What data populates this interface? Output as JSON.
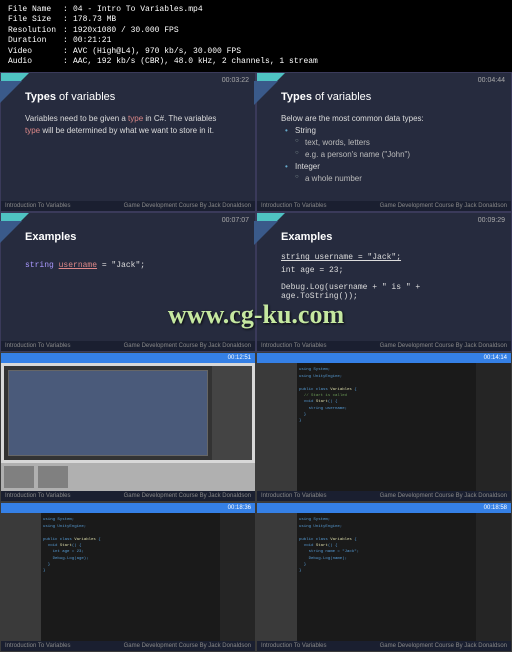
{
  "info": {
    "fileName": {
      "label": "File Name",
      "value": "04 - Intro To Variables.mp4"
    },
    "fileSize": {
      "label": "File Size",
      "value": "178.73 MB"
    },
    "resolution": {
      "label": "Resolution",
      "value": "1920x1080 / 30.000 FPS"
    },
    "duration": {
      "label": "Duration",
      "value": "00:21:21"
    },
    "video": {
      "label": "Video",
      "value": "AVC (High@L4), 970 kb/s, 30.000 FPS"
    },
    "audio": {
      "label": "Audio",
      "value": "AAC, 192 kb/s (CBR), 48.0 kHz, 2 channels, 1 stream"
    }
  },
  "slides": {
    "s1": {
      "ts": "00:03:22",
      "titleBold": "Types",
      "titleRest": " of variables",
      "line1a": "Variables need to be given a ",
      "line1hl": "type",
      "line1b": " in C#. The variables ",
      "line2a": "type",
      "line2b": " will be determined by what we want to store in it."
    },
    "s2": {
      "ts": "00:04:44",
      "titleBold": "Types",
      "titleRest": " of variables",
      "intro": "Below are the most common data types:",
      "b1": "String",
      "b1a": "text, words, letters",
      "b1b": "e.g. a person's name (\"John\")",
      "b2": "Integer",
      "b2a": "a whole number"
    },
    "s3": {
      "ts": "00:07:07",
      "title": "Examples",
      "code1kw": "string",
      "code1var": "username",
      "code1rest": " = \"Jack\";"
    },
    "s4": {
      "ts": "00:09:29",
      "title": "Examples",
      "c1": "string username = \"Jack\";",
      "c2": "int age = 23;",
      "c3": "Debug.Log(username + \" is \" + age.ToString());"
    }
  },
  "ide": {
    "ts5": "00:12:51",
    "ts6": "00:14:14",
    "ts7": "00:18:36",
    "ts8": "00:18:58"
  },
  "footer": {
    "left": "Introduction To Variables",
    "right": "Game Development Course By Jack Donaldson"
  },
  "watermark": "www.cg-ku.com"
}
